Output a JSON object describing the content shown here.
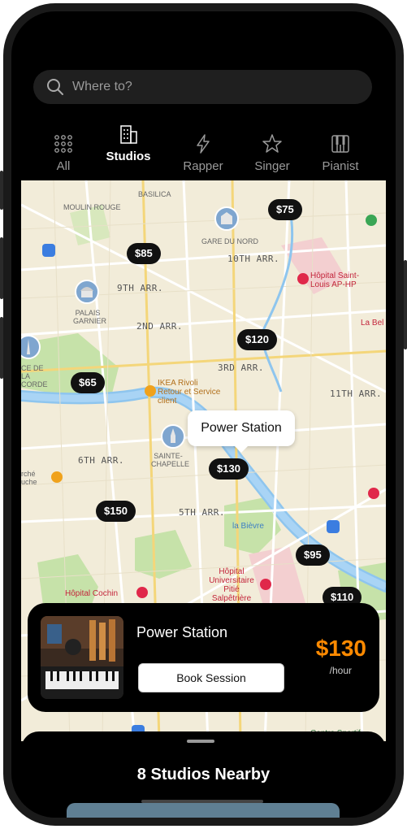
{
  "search": {
    "placeholder": "Where to?"
  },
  "categories": [
    {
      "label": "All",
      "icon": "grid-icon",
      "active": false
    },
    {
      "label": "Studios",
      "icon": "building-icon",
      "active": true
    },
    {
      "label": "Rapper",
      "icon": "lightning-icon",
      "active": false
    },
    {
      "label": "Singer",
      "icon": "star-icon",
      "active": false
    },
    {
      "label": "Pianist",
      "icon": "piano-icon",
      "active": false
    }
  ],
  "map": {
    "district_labels": [
      "10TH ARR.",
      "9TH ARR.",
      "2ND ARR.",
      "3RD ARR.",
      "11TH ARR.",
      "6TH ARR.",
      "5TH ARR."
    ],
    "places": [
      "MOULIN ROUGE",
      "BASILICA",
      "GARE DU NORD",
      "PALAIS GARNIER",
      "SAINTE-CHAPELLE",
      "CE DE LA CORDE",
      "rché uche"
    ],
    "pois": {
      "ikea": "IKEA Rivoli Retour et Service client",
      "hopital_saint_louis": "Hôpital Saint-Louis AP-HP",
      "hopital_cochin": "Hôpital Cochin",
      "pitie": "Hôpital Universitaire Pitié Salpêtrière",
      "la_bel": "La Bel",
      "la_bievre": "la Bièvre",
      "centre_sportif": "Centre Sportif"
    },
    "price_pins": [
      "$75",
      "$85",
      "$120",
      "$65",
      "$130",
      "$150",
      "$95",
      "$110"
    ],
    "callout": "Power Station"
  },
  "card": {
    "title": "Power Station",
    "button": "Book Session",
    "price": "$130",
    "unit": "/hour"
  },
  "sheet": {
    "title": "8 Studios Nearby"
  },
  "colors": {
    "accent": "#ff8a00",
    "pin_bg": "#111111",
    "map_bg": "#f2ecd9"
  }
}
